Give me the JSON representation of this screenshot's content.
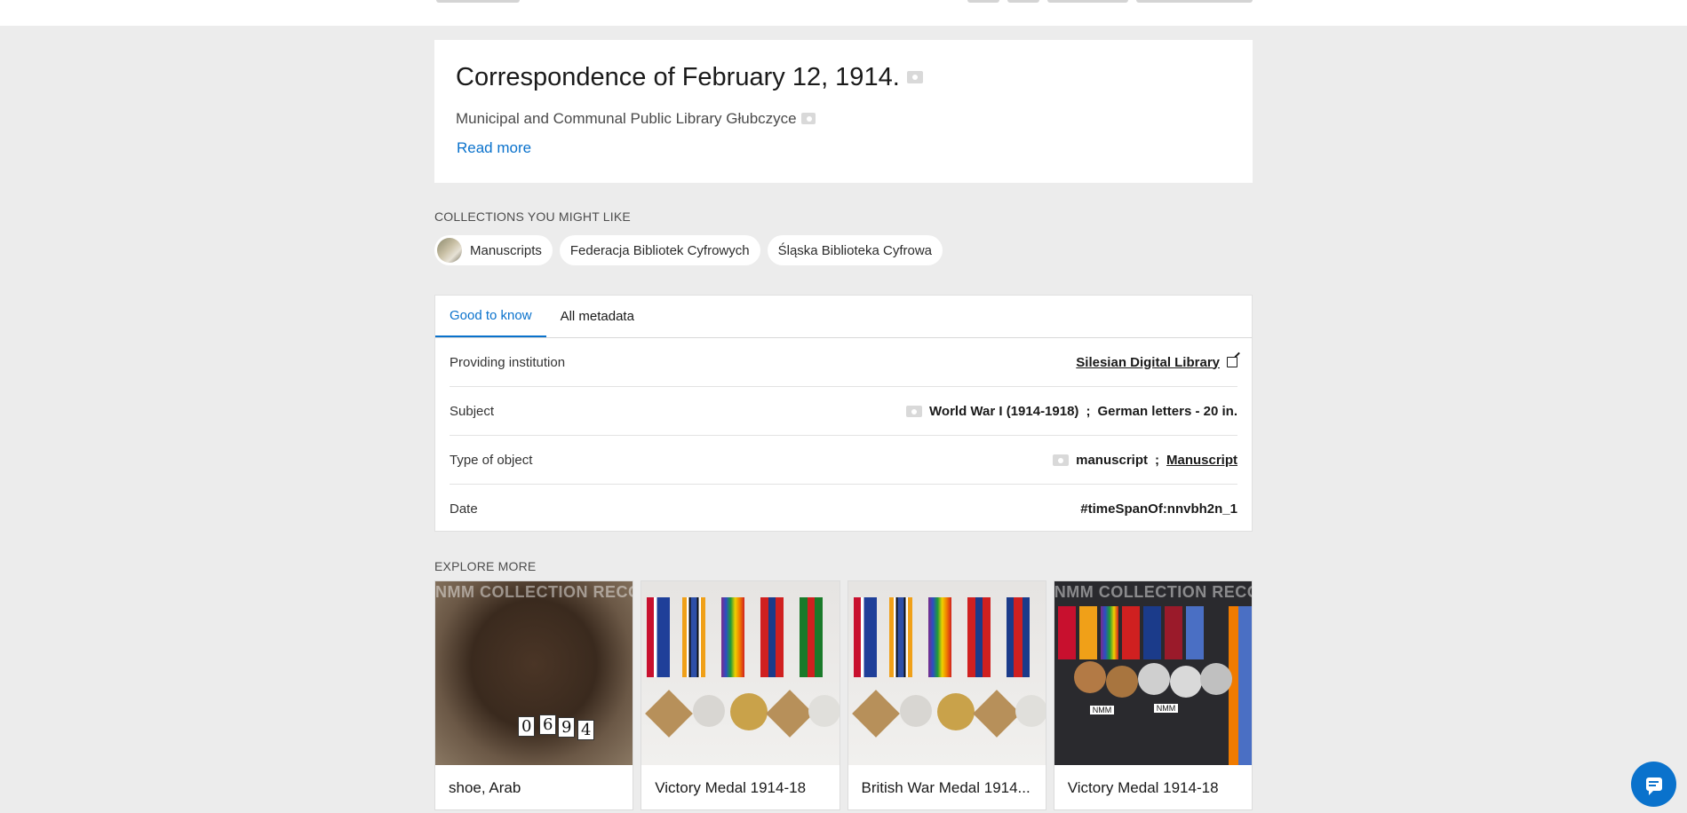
{
  "record": {
    "title": "Correspondence of February 12, 1914.",
    "institution_line": "Municipal and Communal Public Library Głubczyce",
    "read_more": "Read more"
  },
  "collections": {
    "heading": "COLLECTIONS YOU MIGHT LIKE",
    "items": [
      {
        "label": "Manuscripts"
      },
      {
        "label": "Federacja Bibliotek Cyfrowych"
      },
      {
        "label": "Śląska Biblioteka Cyfrowa"
      }
    ]
  },
  "metadata": {
    "tabs": [
      "Good to know",
      "All metadata"
    ],
    "active_tab": "Good to know",
    "rows": [
      {
        "key": "Providing institution",
        "value": "Silesian Digital Library"
      },
      {
        "key": "Subject",
        "value_a": "World War I (1914-1918)",
        "sep": ";",
        "value_b": "German letters - 20 in."
      },
      {
        "key": "Type of object",
        "value_a": "manuscript",
        "sep": ";",
        "value_b": "Manuscript"
      },
      {
        "key": "Date",
        "value": "#timeSpanOf:nnvbh2n_1"
      }
    ]
  },
  "explore": {
    "heading": "EXPLORE MORE",
    "watermark": "NMM COLLECTION RECORD",
    "tag_digits": [
      "0",
      "6",
      "9",
      "4"
    ],
    "medal_tag": "NMM",
    "cards": [
      {
        "title": "shoe, Arab"
      },
      {
        "title": "Victory Medal 1914-18"
      },
      {
        "title": "British War Medal 1914..."
      },
      {
        "title": "Victory Medal 1914-18"
      }
    ]
  },
  "icons": {
    "language": "language-icon",
    "external_link": "external-link-icon",
    "chat": "chat-icon"
  },
  "colors": {
    "accent": "#0a72cc",
    "background": "#ececec"
  }
}
